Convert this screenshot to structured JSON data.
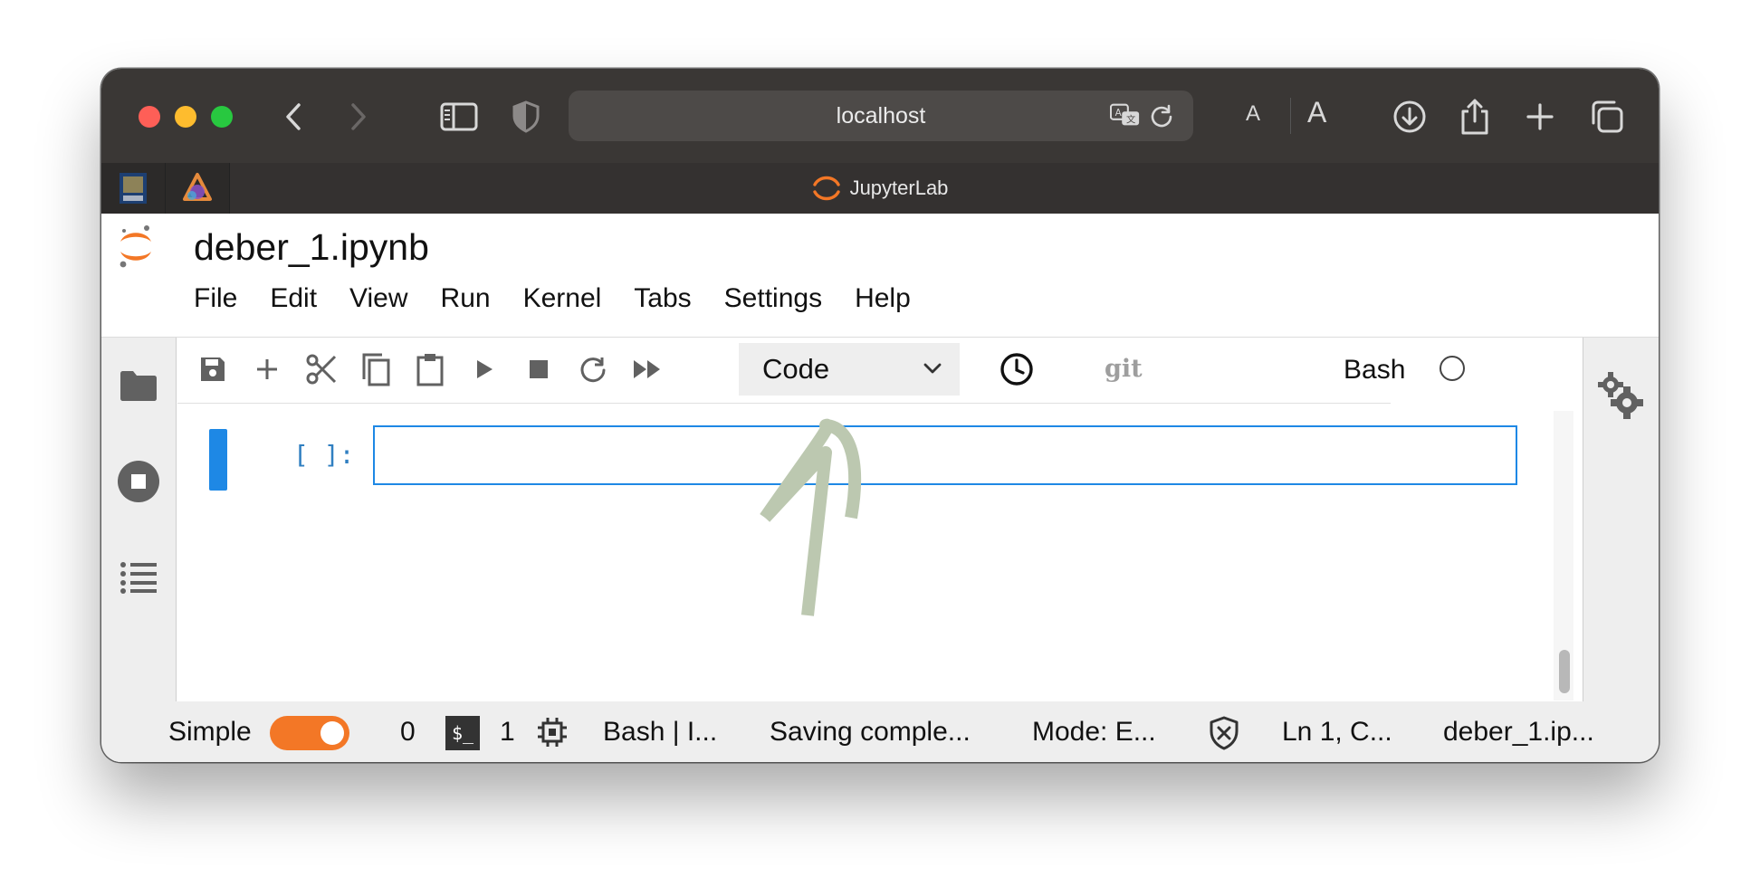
{
  "browser": {
    "url": "localhost",
    "tab_title": "JupyterLab",
    "font_small": "A",
    "font_large": "A",
    "icons": [
      "back-icon",
      "forward-icon",
      "sidebar-icon",
      "shield-icon",
      "translate-icon",
      "reload-icon",
      "download-icon",
      "share-icon",
      "new-tab-icon",
      "tab-overview-icon"
    ]
  },
  "notebook": {
    "title": "deber_1.ipynb",
    "menu": [
      "File",
      "Edit",
      "View",
      "Run",
      "Kernel",
      "Tabs",
      "Settings",
      "Help"
    ]
  },
  "toolbar": {
    "cell_type": "Code",
    "git_label": "git",
    "kernel_name": "Bash"
  },
  "cell": {
    "prompt": "[ ]:",
    "content": ""
  },
  "statusbar": {
    "mode_label": "Simple",
    "terminals_count": "0",
    "terminal_icon_text": "$_",
    "kernels_count": "1",
    "kernel_status": "Bash | I...",
    "save_status": "Saving comple...",
    "editor_mode": "Mode: E...",
    "cursor_position": "Ln 1, C...",
    "file_name": "deber_1.ip..."
  },
  "colors": {
    "accent_orange": "#f37726",
    "cell_blue": "#1e88e5",
    "prompt_blue": "#307fc1",
    "chrome_dark": "#3a3735",
    "annotation_arrow": "#bcc8b0"
  }
}
